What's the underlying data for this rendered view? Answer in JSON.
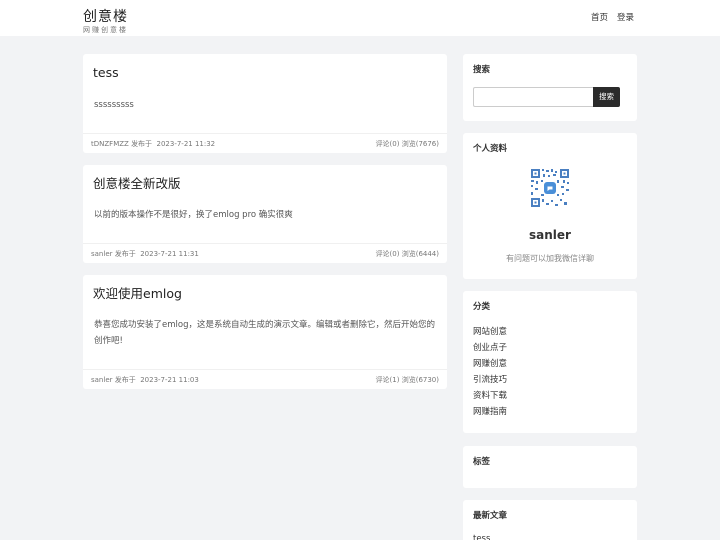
{
  "site": {
    "title": "创意楼",
    "subtitle": "网赚创意楼"
  },
  "nav": {
    "home": "首页",
    "login": "登录"
  },
  "posts": [
    {
      "title": "tess",
      "excerpt": "sssssssss",
      "author": "tDNZFMZZ",
      "published_label": "发布于",
      "date": "2023-7-21 11:32",
      "comments": "评论(0)",
      "views": "浏览(7676)"
    },
    {
      "title": "创意楼全新改版",
      "excerpt": "以前的版本操作不是很好，换了emlog pro 确实很爽",
      "author": "sanler",
      "published_label": "发布于",
      "date": "2023-7-21 11:31",
      "comments": "评论(0)",
      "views": "浏览(6444)"
    },
    {
      "title": "欢迎使用emlog",
      "excerpt": "恭喜您成功安装了emlog，这是系统自动生成的演示文章。编辑或者删除它，然后开始您的创作吧!",
      "author": "sanler",
      "published_label": "发布于",
      "date": "2023-7-21 11:03",
      "comments": "评论(1)",
      "views": "浏览(6730)"
    }
  ],
  "sidebar": {
    "search": {
      "title": "搜索",
      "placeholder": "",
      "button": "搜索"
    },
    "profile": {
      "title": "个人资料",
      "name": "sanler",
      "desc": "有问题可以加我微信详聊"
    },
    "categories": {
      "title": "分类",
      "items": [
        "网站创意",
        "创业点子",
        "网赚创意",
        "引流技巧",
        "资料下载",
        "网赚指南"
      ]
    },
    "tags": {
      "title": "标签"
    },
    "latest": {
      "title": "最新文章",
      "first_item": "tess"
    }
  }
}
